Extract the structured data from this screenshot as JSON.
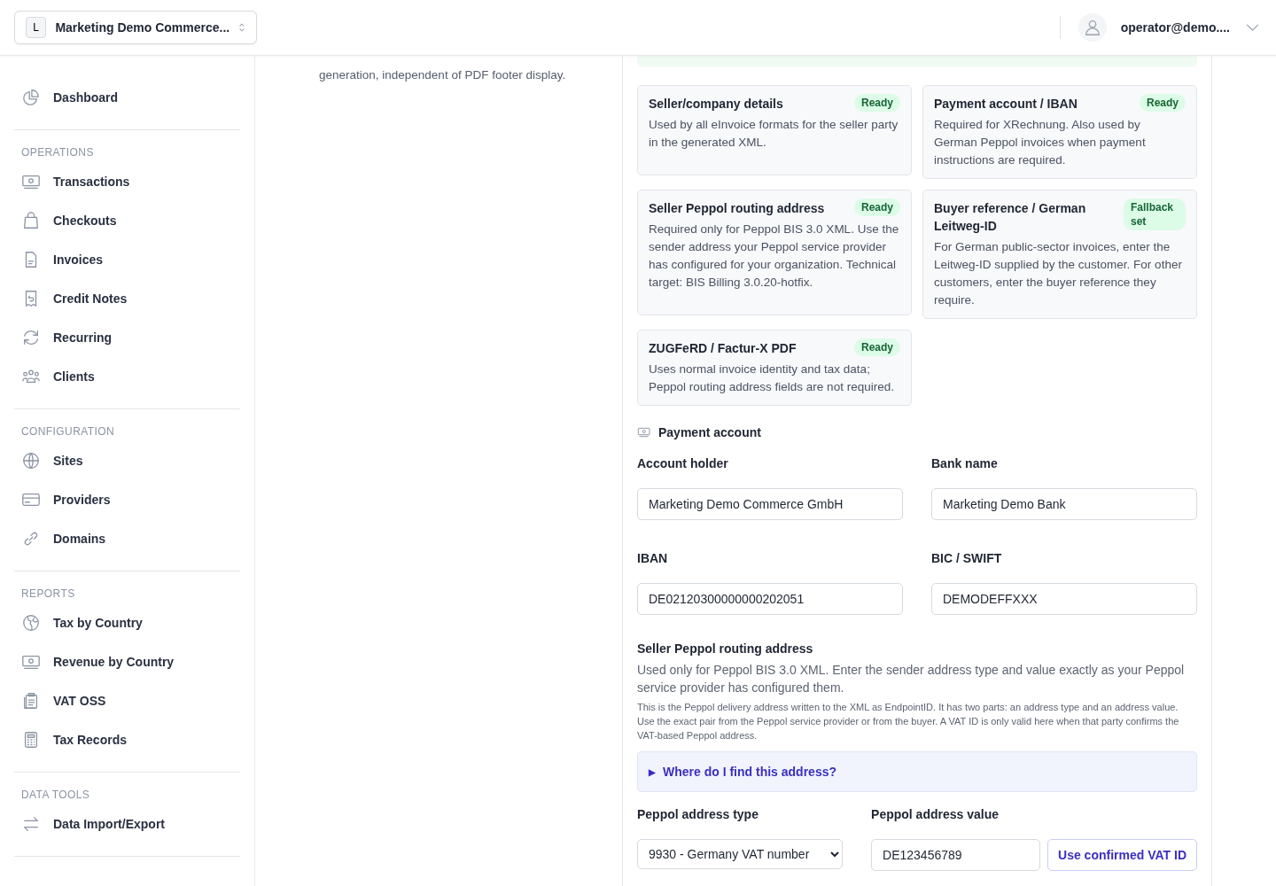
{
  "header": {
    "workspace": {
      "initial": "L",
      "name": "Marketing Demo Commerce..."
    },
    "user": "operator@demo...."
  },
  "sidebar": {
    "top": [
      {
        "label": "Dashboard"
      }
    ],
    "sections": [
      {
        "title": "OPERATIONS",
        "items": [
          {
            "label": "Transactions"
          },
          {
            "label": "Checkouts"
          },
          {
            "label": "Invoices"
          },
          {
            "label": "Credit Notes"
          },
          {
            "label": "Recurring"
          },
          {
            "label": "Clients"
          }
        ]
      },
      {
        "title": "CONFIGURATION",
        "items": [
          {
            "label": "Sites"
          },
          {
            "label": "Providers"
          },
          {
            "label": "Domains"
          }
        ]
      },
      {
        "title": "REPORTS",
        "items": [
          {
            "label": "Tax by Country"
          },
          {
            "label": "Revenue by Country"
          },
          {
            "label": "VAT OSS"
          },
          {
            "label": "Tax Records"
          }
        ]
      },
      {
        "title": "DATA TOOLS",
        "items": [
          {
            "label": "Data Import/Export"
          }
        ]
      }
    ]
  },
  "section_description": "generation, independent of PDF footer display.",
  "readiness_cards": [
    {
      "title": "Seller/company details",
      "badge": "Ready",
      "text": "Used by all eInvoice formats for the seller party in the generated XML."
    },
    {
      "title": "Payment account / IBAN",
      "badge": "Ready",
      "text": "Required for XRechnung. Also used by German Peppol invoices when payment instructions are required."
    },
    {
      "title": "Seller Peppol routing address",
      "badge": "Ready",
      "text": "Required only for Peppol BIS 3.0 XML. Use the sender address your Peppol service provider has configured for your organization. Technical target: BIS Billing 3.0.20-hotfix."
    },
    {
      "title": "Buyer reference / German Leitweg-ID",
      "badge": "Fallback set",
      "text": "For German public-sector invoices, enter the Leitweg-ID supplied by the customer. For other customers, enter the buyer reference they require."
    },
    {
      "title": "ZUGFeRD / Factur-X PDF",
      "badge": "Ready",
      "text": "Uses normal invoice identity and tax data; Peppol routing address fields are not required."
    }
  ],
  "payment_account": {
    "heading": "Payment account",
    "fields": [
      {
        "label": "Account holder",
        "value": "Marketing Demo Commerce GmbH"
      },
      {
        "label": "Bank name",
        "value": "Marketing Demo Bank"
      },
      {
        "label": "IBAN",
        "value": "DE02120300000000202051"
      },
      {
        "label": "BIC / SWIFT",
        "value": "DEMODEFFXXX"
      }
    ]
  },
  "peppol": {
    "heading": "Seller Peppol routing address",
    "lead": "Used only for Peppol BIS 3.0 XML. Enter the sender address type and value exactly as your Peppol service provider has configured them.",
    "note": "This is the Peppol delivery address written to the XML as EndpointID. It has two parts: an address type and an address value. Use the exact pair from the Peppol service provider or from the buyer. A VAT ID is only valid here when that party confirms the VAT-based Peppol address.",
    "disclosure": {
      "marker": "▶",
      "label": "Where do I find this address?",
      "expanded": false
    },
    "type_label": "Peppol address type",
    "type_value": "9930 - Germany VAT number",
    "value_label": "Peppol address value",
    "value": "DE123456789",
    "action": "Use confirmed VAT ID"
  }
}
